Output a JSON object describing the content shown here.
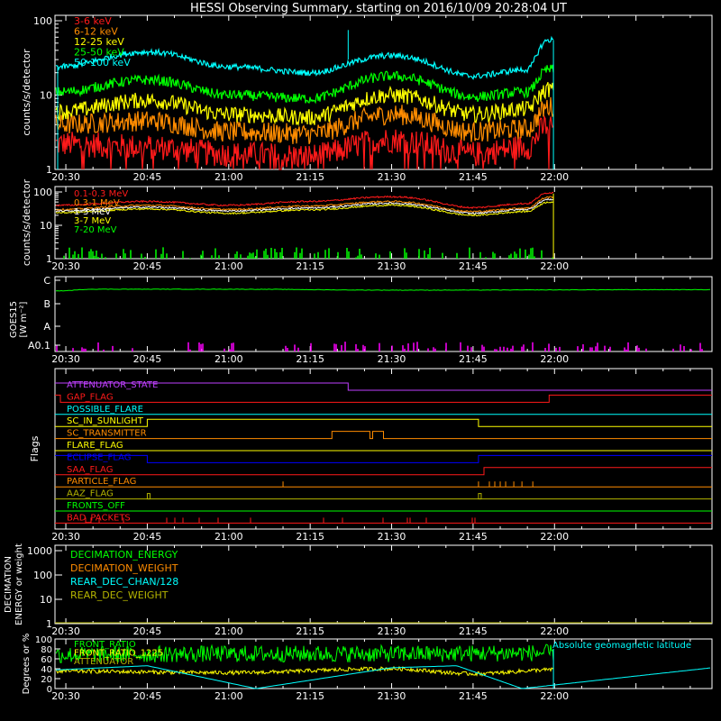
{
  "title": "HESSI Observing Summary, starting on 2016/10/09 20:28:04 UT",
  "colors": {
    "background": "#000000",
    "axes": "#ffffff",
    "red": "#ff1a1a",
    "orange": "#ff8c00",
    "yellow": "#ffff00",
    "green": "#00ff00",
    "cyan": "#00ffff",
    "magenta": "#ff00ff",
    "blue": "#0000ff",
    "olive": "#b4b400",
    "violet": "#c040ff"
  },
  "chart_data": [
    {
      "id": "low-energy",
      "type": "line",
      "ylabel": "counts/s/detector",
      "yscale": "log",
      "ylim": [
        1,
        100
      ],
      "ytick_labels": [
        "1",
        "10",
        "100"
      ],
      "xlim": [
        "20:28",
        "22:29"
      ],
      "x_tick_labels": [
        "20:30",
        "20:45",
        "21:00",
        "21:15",
        "21:30",
        "21:45",
        "22:00"
      ],
      "legend_position": "top-left",
      "series": [
        {
          "name": "3-6 keV",
          "color": "#ff1a1a",
          "keypoints": [
            [
              "20:29",
              2.2
            ],
            [
              "20:45",
              2.0
            ],
            [
              "21:00",
              1.6
            ],
            [
              "21:15",
              1.5
            ],
            [
              "21:30",
              2.5
            ],
            [
              "21:45",
              1.6
            ],
            [
              "21:55",
              2.0
            ],
            [
              "21:59",
              4.0
            ]
          ]
        },
        {
          "name": "6-12 keV",
          "color": "#ff8c00",
          "keypoints": [
            [
              "20:29",
              4
            ],
            [
              "20:45",
              4.5
            ],
            [
              "21:00",
              3.2
            ],
            [
              "21:15",
              3.0
            ],
            [
              "21:30",
              5.5
            ],
            [
              "21:45",
              3.2
            ],
            [
              "21:55",
              3.5
            ],
            [
              "21:59",
              7
            ]
          ]
        },
        {
          "name": "12-25 keV",
          "color": "#ffff00",
          "keypoints": [
            [
              "20:29",
              6
            ],
            [
              "20:45",
              8.5
            ],
            [
              "21:00",
              5.5
            ],
            [
              "21:15",
              5.0
            ],
            [
              "21:30",
              10
            ],
            [
              "21:45",
              5.5
            ],
            [
              "21:55",
              6.5
            ],
            [
              "21:59",
              12
            ]
          ]
        },
        {
          "name": "25-50 keV",
          "color": "#00ff00",
          "keypoints": [
            [
              "20:29",
              11
            ],
            [
              "20:45",
              16
            ],
            [
              "21:00",
              10
            ],
            [
              "21:15",
              9
            ],
            [
              "21:30",
              18
            ],
            [
              "21:45",
              9.5
            ],
            [
              "21:55",
              11
            ],
            [
              "21:59",
              22
            ]
          ]
        },
        {
          "name": "50-100 keV",
          "color": "#00ffff",
          "keypoints": [
            [
              "20:29",
              24
            ],
            [
              "20:45",
              38
            ],
            [
              "21:00",
              24
            ],
            [
              "21:15",
              20
            ],
            [
              "21:30",
              34
            ],
            [
              "21:45",
              18
            ],
            [
              "21:55",
              22
            ],
            [
              "21:59",
              55
            ]
          ]
        }
      ]
    },
    {
      "id": "high-energy",
      "type": "line",
      "ylabel": "counts/s/detector",
      "yscale": "log",
      "ylim": [
        1,
        100
      ],
      "ytick_labels": [
        "1",
        "10",
        "100"
      ],
      "x_tick_labels": [
        "20:30",
        "20:45",
        "21:00",
        "21:15",
        "21:30",
        "21:45",
        "22:00"
      ],
      "legend_position": "top-left",
      "series": [
        {
          "name": "0.1-0.3 MeV",
          "color": "#ff1a1a",
          "keypoints": [
            [
              "20:29",
              40
            ],
            [
              "20:45",
              52
            ],
            [
              "21:00",
              40
            ],
            [
              "21:15",
              52
            ],
            [
              "21:30",
              72
            ],
            [
              "21:45",
              34
            ],
            [
              "21:55",
              45
            ],
            [
              "21:59",
              95
            ]
          ]
        },
        {
          "name": "0.3-1 MeV",
          "color": "#ff8c00",
          "keypoints": [
            [
              "20:29",
              30
            ],
            [
              "20:45",
              40
            ],
            [
              "21:00",
              30
            ],
            [
              "21:15",
              38
            ],
            [
              "21:30",
              52
            ],
            [
              "21:45",
              26
            ],
            [
              "21:55",
              33
            ],
            [
              "21:59",
              70
            ]
          ]
        },
        {
          "name": "1-3 MeV",
          "color": "#ffffff",
          "keypoints": [
            [
              "20:29",
              27
            ],
            [
              "20:45",
              35
            ],
            [
              "21:00",
              27
            ],
            [
              "21:15",
              33
            ],
            [
              "21:30",
              46
            ],
            [
              "21:45",
              23
            ],
            [
              "21:55",
              30
            ],
            [
              "21:59",
              60
            ]
          ]
        },
        {
          "name": "3-7 MeV",
          "color": "#ffff00",
          "keypoints": [
            [
              "20:29",
              24
            ],
            [
              "20:45",
              31
            ],
            [
              "21:00",
              23
            ],
            [
              "21:15",
              29
            ],
            [
              "21:30",
              40
            ],
            [
              "21:45",
              20
            ],
            [
              "21:55",
              26
            ],
            [
              "21:59",
              50
            ]
          ]
        },
        {
          "name": "7-20 MeV",
          "color": "#00ff00",
          "keypoints": [
            [
              "20:29",
              1.4
            ],
            [
              "22:00",
              1.4
            ]
          ]
        }
      ]
    },
    {
      "id": "goes",
      "type": "line",
      "ylabel": "GOES15",
      "ylabel2": "[W m⁻²]",
      "yscale": "log",
      "ytick_labels": [
        "A0.1",
        "A",
        "B",
        "C"
      ],
      "x_tick_labels": [
        "20:30",
        "20:45",
        "21:00",
        "21:15",
        "21:30",
        "21:45",
        "22:00"
      ],
      "series": [
        {
          "name": "GOES long",
          "color": "#00ff00",
          "keypoints": [
            [
              "20:29",
              2.55
            ],
            [
              "20:35",
              2.62
            ],
            [
              "21:00",
              2.62
            ],
            [
              "21:30",
              2.58
            ],
            [
              "22:29",
              2.6
            ]
          ]
        },
        {
          "name": "GOES short",
          "color": "#ff00ff",
          "keypoints": [
            [
              "20:29",
              0.0
            ],
            [
              "22:29",
              0.0
            ]
          ]
        }
      ]
    },
    {
      "id": "flags",
      "type": "line",
      "ylabel": "Flags",
      "x_tick_labels": [
        "20:30",
        "20:45",
        "21:00",
        "21:15",
        "21:30",
        "21:45",
        "22:00"
      ],
      "series": [
        {
          "name": "ATTENUATOR_STATE",
          "color": "#c040ff",
          "transitions": [
            [
              "20:28",
              1
            ],
            [
              "21:22",
              0
            ]
          ]
        },
        {
          "name": "SAA_FLAG",
          "color": "#ff1a1a",
          "transitions": [
            [
              "20:28",
              1
            ],
            [
              "20:29",
              0
            ],
            [
              "21:59",
              1
            ]
          ]
        },
        {
          "name": "POSSIBLE_FLARE",
          "color": "#00ffff",
          "transitions": [
            [
              "20:28",
              0
            ]
          ]
        },
        {
          "name": "SC_IN_SUNLIGHT",
          "color": "#ffff00",
          "transitions": [
            [
              "20:28",
              0
            ],
            [
              "20:45",
              1
            ],
            [
              "21:46",
              0
            ]
          ]
        },
        {
          "name": "SC_TRANSMITTER",
          "color": "#ff8c00",
          "transitions": [
            [
              "20:28",
              0
            ],
            [
              "21:19",
              1
            ],
            [
              "21:26",
              0
            ],
            [
              "21:26.5",
              1
            ],
            [
              "21:28.5",
              0
            ]
          ]
        },
        {
          "name": "FLARE_FLAG",
          "color": "#ffff00",
          "transitions": [
            [
              "20:28",
              0
            ]
          ]
        },
        {
          "name": "ECLIPSE_FLAG",
          "color": "#0000ff",
          "transitions": [
            [
              "20:28",
              1
            ],
            [
              "20:45",
              0
            ],
            [
              "21:46",
              1
            ]
          ]
        },
        {
          "name": "SAA_FLAG",
          "color": "#ff1a1a",
          "transitions": [
            [
              "20:28",
              0
            ],
            [
              "21:47",
              1
            ]
          ]
        },
        {
          "name": "PARTICLE_FLAG",
          "color": "#ff8c00",
          "transitions": [
            [
              "20:28",
              0
            ]
          ]
        },
        {
          "name": "AAZ_FLAG",
          "color": "#b4b400",
          "transitions": [
            [
              "20:28",
              0
            ]
          ]
        },
        {
          "name": "FRONTS_OFF",
          "color": "#00ff00",
          "transitions": [
            [
              "20:28",
              0
            ]
          ]
        },
        {
          "name": "BAD_PACKETS",
          "color": "#ff1a1a",
          "transitions": [
            [
              "20:28",
              0
            ]
          ]
        }
      ],
      "legend_names": [
        "ATTENUATOR_STATE",
        "GAP_FLAG",
        "POSSIBLE_FLARE",
        "SC_IN_SUNLIGHT",
        "SC_TRANSMITTER",
        "FLARE_FLAG",
        "ECLIPSE_FLAG",
        "SAA_FLAG",
        "PARTICLE_FLAG",
        "AAZ_FLAG",
        "FRONTS_OFF",
        "BAD_PACKETS"
      ]
    },
    {
      "id": "decimation",
      "type": "line",
      "ylabel": "DECIMATION",
      "ylabel2": "ENERGY or weight",
      "yscale": "log",
      "ylim": [
        1,
        1000
      ],
      "ytick_labels": [
        "1",
        "10",
        "100",
        "1000"
      ],
      "x_tick_labels": [
        "20:30",
        "20:45",
        "21:00",
        "21:15",
        "21:30",
        "21:45",
        "22:00"
      ],
      "series": [
        {
          "name": "DECIMATION_ENERGY",
          "color": "#00ff00"
        },
        {
          "name": "DECIMATION_WEIGHT",
          "color": "#ff8c00"
        },
        {
          "name": "REAR_DEC_CHAN/128",
          "color": "#00ffff"
        },
        {
          "name": "REAR_DEC_WEIGHT",
          "color": "#b4b400"
        }
      ]
    },
    {
      "id": "ratio",
      "type": "line",
      "ylabel": "Degrees or %",
      "ylim": [
        0,
        100
      ],
      "ytick_labels": [
        "0",
        "20",
        "40",
        "60",
        "80",
        "100"
      ],
      "x_tick_labels": [
        "20:30",
        "20:45",
        "21:00",
        "21:15",
        "21:30",
        "21:45",
        "22:00"
      ],
      "annotation": "Absolute geomagnetic latitude",
      "series": [
        {
          "name": "FRONT_RATIO",
          "color": "#00ff00",
          "keypoints": [
            [
              "20:29",
              68
            ],
            [
              "21:00",
              70
            ],
            [
              "21:30",
              70
            ],
            [
              "22:00",
              72
            ]
          ]
        },
        {
          "name": "FRONT_RATIO_1225",
          "color": "#ffff00",
          "keypoints": [
            [
              "20:29",
              35
            ],
            [
              "21:00",
              32
            ],
            [
              "21:30",
              40
            ],
            [
              "21:45",
              30
            ],
            [
              "22:00",
              38
            ]
          ]
        },
        {
          "name": "ATTENUATOR",
          "color": "#b4b400"
        },
        {
          "name": "Absolute geomagnetic latitude",
          "color": "#00ffff",
          "keypoints": [
            [
              "20:29",
              38
            ],
            [
              "20:45",
              46
            ],
            [
              "21:05",
              0
            ],
            [
              "21:30",
              42
            ],
            [
              "21:42",
              46
            ],
            [
              "21:54",
              0
            ],
            [
              "22:29",
              42
            ]
          ]
        }
      ]
    }
  ]
}
